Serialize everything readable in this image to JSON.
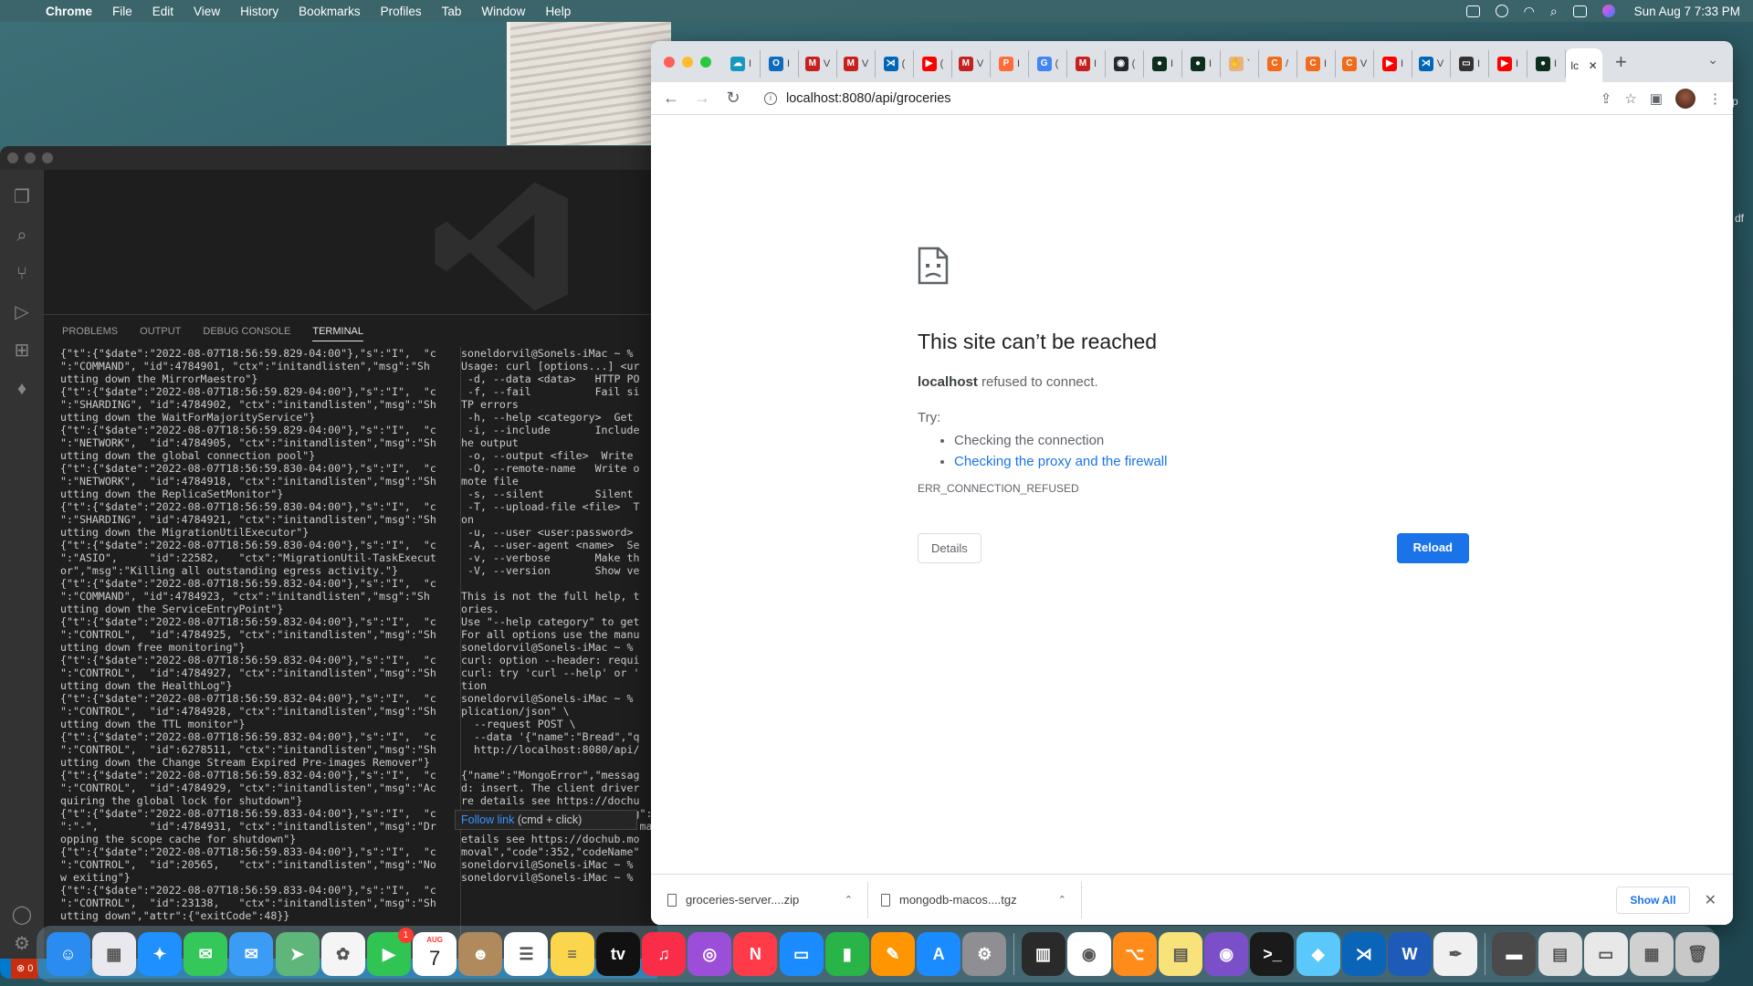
{
  "menubar": {
    "app_name": "Chrome",
    "items": [
      "File",
      "Edit",
      "View",
      "History",
      "Bookmarks",
      "Profiles",
      "Tab",
      "Window",
      "Help"
    ],
    "clock": "Sun Aug 7  7:33 PM"
  },
  "desktop": {
    "edge_text": "df"
  },
  "vscode": {
    "panel_tabs": [
      "PROBLEMS",
      "OUTPUT",
      "DEBUG CONSOLE",
      "TERMINAL"
    ],
    "active_panel_tab": "TERMINAL",
    "terminal_left": "{\"t\":{\"$date\":\"2022-08-07T18:56:59.829-04:00\"},\"s\":\"I\",  \"c\n\":\"COMMAND\", \"id\":4784901, \"ctx\":\"initandlisten\",\"msg\":\"Sh\nutting down the MirrorMaestro\"}\n{\"t\":{\"$date\":\"2022-08-07T18:56:59.829-04:00\"},\"s\":\"I\",  \"c\n\":\"SHARDING\", \"id\":4784902, \"ctx\":\"initandlisten\",\"msg\":\"Sh\nutting down the WaitForMajorityService\"}\n{\"t\":{\"$date\":\"2022-08-07T18:56:59.829-04:00\"},\"s\":\"I\",  \"c\n\":\"NETWORK\",  \"id\":4784905, \"ctx\":\"initandlisten\",\"msg\":\"Sh\nutting down the global connection pool\"}\n{\"t\":{\"$date\":\"2022-08-07T18:56:59.830-04:00\"},\"s\":\"I\",  \"c\n\":\"NETWORK\",  \"id\":4784918, \"ctx\":\"initandlisten\",\"msg\":\"Sh\nutting down the ReplicaSetMonitor\"}\n{\"t\":{\"$date\":\"2022-08-07T18:56:59.830-04:00\"},\"s\":\"I\",  \"c\n\":\"SHARDING\", \"id\":4784921, \"ctx\":\"initandlisten\",\"msg\":\"Sh\nutting down the MigrationUtilExecutor\"}\n{\"t\":{\"$date\":\"2022-08-07T18:56:59.830-04:00\"},\"s\":\"I\",  \"c\n\":\"ASIO\",     \"id\":22582,   \"ctx\":\"MigrationUtil-TaskExecut\nor\",\"msg\":\"Killing all outstanding egress activity.\"}\n{\"t\":{\"$date\":\"2022-08-07T18:56:59.832-04:00\"},\"s\":\"I\",  \"c\n\":\"COMMAND\", \"id\":4784923, \"ctx\":\"initandlisten\",\"msg\":\"Sh\nutting down the ServiceEntryPoint\"}\n{\"t\":{\"$date\":\"2022-08-07T18:56:59.832-04:00\"},\"s\":\"I\",  \"c\n\":\"CONTROL\",  \"id\":4784925, \"ctx\":\"initandlisten\",\"msg\":\"Sh\nutting down free monitoring\"}\n{\"t\":{\"$date\":\"2022-08-07T18:56:59.832-04:00\"},\"s\":\"I\",  \"c\n\":\"CONTROL\",  \"id\":4784927, \"ctx\":\"initandlisten\",\"msg\":\"Sh\nutting down the HealthLog\"}\n{\"t\":{\"$date\":\"2022-08-07T18:56:59.832-04:00\"},\"s\":\"I\",  \"c\n\":\"CONTROL\",  \"id\":4784928, \"ctx\":\"initandlisten\",\"msg\":\"Sh\nutting down the TTL monitor\"}\n{\"t\":{\"$date\":\"2022-08-07T18:56:59.832-04:00\"},\"s\":\"I\",  \"c\n\":\"CONTROL\",  \"id\":6278511, \"ctx\":\"initandlisten\",\"msg\":\"Sh\nutting down the Change Stream Expired Pre-images Remover\"}\n{\"t\":{\"$date\":\"2022-08-07T18:56:59.832-04:00\"},\"s\":\"I\",  \"c\n\":\"CONTROL\",  \"id\":4784929, \"ctx\":\"initandlisten\",\"msg\":\"Ac\nquiring the global lock for shutdown\"}\n{\"t\":{\"$date\":\"2022-08-07T18:56:59.833-04:00\"},\"s\":\"I\",  \"c\n\":\"-\",        \"id\":4784931, \"ctx\":\"initandlisten\",\"msg\":\"Dr\nopping the scope cache for shutdown\"}\n{\"t\":{\"$date\":\"2022-08-07T18:56:59.833-04:00\"},\"s\":\"I\",  \"c\n\":\"CONTROL\",  \"id\":20565,   \"ctx\":\"initandlisten\",\"msg\":\"No\nw exiting\"}\n{\"t\":{\"$date\":\"2022-08-07T18:56:59.833-04:00\"},\"s\":\"I\",  \"c\n\":\"CONTROL\",  \"id\":23138,   \"ctx\":\"initandlisten\",\"msg\":\"Sh\nutting down\",\"attr\":{\"exitCode\":48}}",
    "terminal_right": "soneldorvil@Sonels-iMac ~ %\nUsage: curl [options...] <ur\n -d, --data <data>   HTTP PO\n -f, --fail          Fail si\nTP errors\n -h, --help <category>  Get\n -i, --include       Include\nhe output\n -o, --output <file>  Write\n -O, --remote-name   Write o\nmote file\n -s, --silent        Silent\n -T, --upload-file <file>  T\non\n -u, --user <user:password>\n -A, --user-agent <name>  Se\n -v, --verbose       Make th\n -V, --version       Show ve\n\nThis is not the full help, t\nories.\nUse \"--help category\" to get\nFor all options use the manu\nsoneldorvil@Sonels-iMac ~ %\ncurl: option --header: requi\ncurl: try 'curl --help' or '\ntion\nsoneldorvil@Sonels-iMac ~ %\nplication/json\" \\\n  --request POST \\\n  --data '{\"name\":\"Bread\",\"q\n  http://localhost:8080/api/\n\n{\"name\":\"MongoError\",\"messag\nd: insert. The client driver\nre details see https://dochu\n                         msg\":\"\n                         er may\netails see https://dochub.mo\nmoval\",\"code\":352,\"codeName\"\nsoneldorvil@Sonels-iMac ~ %\nsoneldorvil@Sonels-iMac ~ %",
    "follow_link": "Follow link",
    "follow_hint": " (cmd + click)",
    "status_errors": "⊗ 0"
  },
  "chrome": {
    "tabs": [
      {
        "icon": "salesforce-icon",
        "color": "#1798c1",
        "glyph": "☁",
        "label": "I"
      },
      {
        "icon": "outlook-icon",
        "color": "#0f6cbd",
        "glyph": "O",
        "label": "I"
      },
      {
        "icon": "gmail-icon",
        "color": "#c5221f",
        "glyph": "M",
        "label": "V"
      },
      {
        "icon": "gmail-icon",
        "color": "#c5221f",
        "glyph": "M",
        "label": "V"
      },
      {
        "icon": "vscode-icon",
        "color": "#0066b8",
        "glyph": "⋊",
        "label": "("
      },
      {
        "icon": "youtube-icon",
        "color": "#ff0000",
        "glyph": "▶",
        "label": "("
      },
      {
        "icon": "gmail-icon",
        "color": "#c5221f",
        "glyph": "M",
        "label": "V"
      },
      {
        "icon": "postman-icon",
        "color": "#ff6c37",
        "glyph": "P",
        "label": "I"
      },
      {
        "icon": "google-icon",
        "color": "#4285f4",
        "glyph": "G",
        "label": "("
      },
      {
        "icon": "gmail-icon",
        "color": "#c5221f",
        "glyph": "M",
        "label": "I"
      },
      {
        "icon": "github-icon",
        "color": "#24292f",
        "glyph": "◉",
        "label": "("
      },
      {
        "icon": "mongodb-icon",
        "color": "#0d2e1c",
        "glyph": "●",
        "label": "I"
      },
      {
        "icon": "mongodb-icon",
        "color": "#0d2e1c",
        "glyph": "●",
        "label": "I"
      },
      {
        "icon": "hand-icon",
        "color": "#e8b47a",
        "glyph": "✋",
        "label": "`"
      },
      {
        "icon": "codecademy-icon",
        "color": "#f26a1b",
        "glyph": "C",
        "label": "/"
      },
      {
        "icon": "codecademy-icon",
        "color": "#f26a1b",
        "glyph": "C",
        "label": "I"
      },
      {
        "icon": "codecademy-icon",
        "color": "#f26a1b",
        "glyph": "C",
        "label": "V"
      },
      {
        "icon": "youtube-icon",
        "color": "#ff0000",
        "glyph": "▶",
        "label": "I"
      },
      {
        "icon": "vscode-icon",
        "color": "#0066b8",
        "glyph": "⋊",
        "label": "V"
      },
      {
        "icon": "terminal-icon",
        "color": "#333333",
        "glyph": "▭",
        "label": "I"
      },
      {
        "icon": "youtube-icon",
        "color": "#ff0000",
        "glyph": "▶",
        "label": "I"
      },
      {
        "icon": "mongodb-icon",
        "color": "#0d2e1c",
        "glyph": "●",
        "label": "I"
      }
    ],
    "active_tab_label": "lc",
    "url": "localhost:8080/api/groceries",
    "error": {
      "title": "This site can’t be reached",
      "host": "localhost",
      "reason": " refused to connect.",
      "try_label": "Try:",
      "suggestion_1": "Checking the connection",
      "suggestion_2": "Checking the proxy and the firewall",
      "code": "ERR_CONNECTION_REFUSED",
      "details_button": "Details",
      "reload_button": "Reload"
    },
    "downloads": [
      {
        "name": "groceries-server....zip"
      },
      {
        "name": "mongodb-macos....tgz"
      }
    ],
    "show_all": "Show All"
  },
  "dock": {
    "calendar_month": "AUG",
    "calendar_day": "7",
    "facetime_badge": "1",
    "apps": [
      {
        "name": "finder-icon",
        "color": "#2a8cf0",
        "glyph": "☺"
      },
      {
        "name": "launchpad-icon",
        "color": "#e8e8ee",
        "glyph": "▦"
      },
      {
        "name": "safari-icon",
        "color": "#1e90ff",
        "glyph": "✦"
      },
      {
        "name": "messages-icon",
        "color": "#34c759",
        "glyph": "✉"
      },
      {
        "name": "mail-icon",
        "color": "#3b9cf5",
        "glyph": "✉"
      },
      {
        "name": "maps-icon",
        "color": "#5fb67a",
        "glyph": "➤"
      },
      {
        "name": "photos-icon",
        "color": "#f5f5f5",
        "glyph": "✿"
      },
      {
        "name": "facetime-icon",
        "color": "#30c453",
        "glyph": "▶"
      },
      {
        "name": "calendar-icon",
        "color": "#ffffff",
        "glyph": ""
      },
      {
        "name": "contacts-icon",
        "color": "#b08a5c",
        "glyph": "☻"
      },
      {
        "name": "reminders-icon",
        "color": "#ffffff",
        "glyph": "☰"
      },
      {
        "name": "notes-icon",
        "color": "#fbd54b",
        "glyph": "≡"
      },
      {
        "name": "appletv-icon",
        "color": "#111111",
        "glyph": "tv"
      },
      {
        "name": "music-icon",
        "color": "#fa2d48",
        "glyph": "♫"
      },
      {
        "name": "podcasts-icon",
        "color": "#9b4fd9",
        "glyph": "◎"
      },
      {
        "name": "news-icon",
        "color": "#ff3b4a",
        "glyph": "N"
      },
      {
        "name": "keynote-icon",
        "color": "#1a8cff",
        "glyph": "▭"
      },
      {
        "name": "numbers-icon",
        "color": "#28b446",
        "glyph": "▮"
      },
      {
        "name": "pages-icon",
        "color": "#ff9500",
        "glyph": "✎"
      },
      {
        "name": "appstore-icon",
        "color": "#1a8cff",
        "glyph": "A"
      },
      {
        "name": "system-preferences-icon",
        "color": "#8e8e93",
        "glyph": "⚙"
      },
      {
        "name": "piano-icon",
        "color": "#2a2a2a",
        "glyph": "▥"
      },
      {
        "name": "chrome-icon",
        "color": "#ffffff",
        "glyph": "◉"
      },
      {
        "name": "sourcetree-icon",
        "color": "#ff8c1a",
        "glyph": "⌥"
      },
      {
        "name": "stickies-icon",
        "color": "#f8e27a",
        "glyph": "▤"
      },
      {
        "name": "github-desktop-icon",
        "color": "#7b4fc8",
        "glyph": "◉"
      },
      {
        "name": "terminal-icon",
        "color": "#1a1a1a",
        "glyph": ">_"
      },
      {
        "name": "screenshot-app-icon",
        "color": "#5ac8fa",
        "glyph": "◆"
      },
      {
        "name": "vscode-icon",
        "color": "#0a64b8",
        "glyph": "⋊"
      },
      {
        "name": "word-icon",
        "color": "#1e5bb8",
        "glyph": "W"
      },
      {
        "name": "textedit-icon",
        "color": "#f0f0f0",
        "glyph": "✒"
      },
      {
        "name": "downloads-stack-icon",
        "color": "#4a4a4a",
        "glyph": "▬"
      },
      {
        "name": "documents-stack-icon",
        "color": "#dcdcdc",
        "glyph": "▤"
      },
      {
        "name": "desktop-stack-icon",
        "color": "#e8e8e8",
        "glyph": "▭"
      },
      {
        "name": "files-stack-icon",
        "color": "#d0d0d0",
        "glyph": "▦"
      },
      {
        "name": "trash-icon",
        "color": "#c8c8c8",
        "glyph": "🗑"
      }
    ]
  }
}
